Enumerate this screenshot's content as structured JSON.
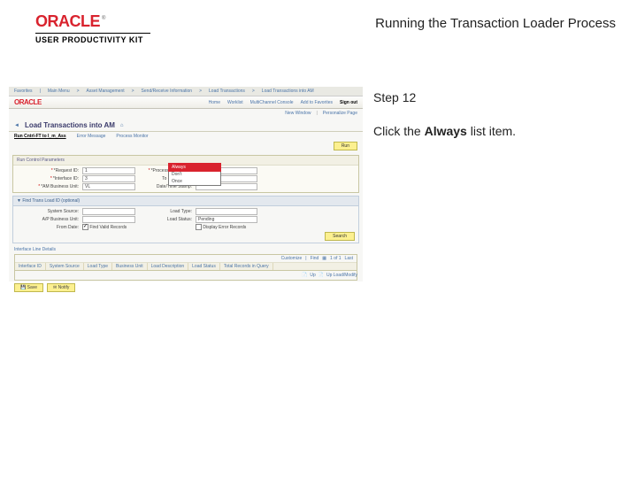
{
  "header": {
    "brand": "ORACLE",
    "sub": "USER PRODUCTIVITY KIT",
    "title": "Running the Transaction Loader Process"
  },
  "instr": {
    "step": "Step 12",
    "text_before": "Click the ",
    "bold": "Always",
    "text_after": " list item."
  },
  "screenshot": {
    "nav": [
      "Favorites",
      "Main Menu",
      "Asset Management",
      "Send/Receive Information",
      "Load Transactions",
      "Load Transactions into AM"
    ],
    "brand": "ORACLE",
    "top_links": [
      "Home",
      "Worklist",
      "MultiChannel Console",
      "Add to Favorites"
    ],
    "signout": "Sign out",
    "new_window": "New Window",
    "personalize": "Personalize Page",
    "back_symbol": "◄",
    "page_title": "Load Transactions into AM",
    "tabs": [
      "Run Cntrl-FT to I_m_Ass",
      "Error Message",
      "Process Monitor"
    ],
    "run_btn": "Run",
    "group1": {
      "title": "Run Control Parameters",
      "rows": {
        "request_id": {
          "label": "*Request ID:",
          "value": "1"
        },
        "process_freq": {
          "label": "*Process Frequency:",
          "value": "Always"
        },
        "interface_id": {
          "label": "*Interface ID:",
          "value": "3"
        },
        "to_interface": {
          "label": "To Interface ID:",
          "value": ""
        },
        "am_bu": {
          "label": "*AM Business Unit:",
          "value": "VL"
        },
        "datetime_stamp": {
          "label": "Date/Time Stamp:",
          "value": ""
        }
      },
      "dropdown_options": [
        "Always",
        "Don't",
        "Once"
      ],
      "dropdown_highlight": "Always"
    },
    "group2": {
      "title": "▼ Find Trans Load ID (optional)",
      "rows": {
        "system_source": {
          "label": "System Source:",
          "value": ""
        },
        "load_type": {
          "label": "Load Type:",
          "value": ""
        },
        "ap_bu": {
          "label": "A/P Business Unit:",
          "value": ""
        },
        "load_status": {
          "label": "Load Status:",
          "value": "Pending"
        },
        "from_date": {
          "label": "From Date:",
          "value": ""
        },
        "find_valid": {
          "label": "Find Valid Records",
          "checked": true
        },
        "display_err": {
          "label": "Display Error Records",
          "checked": false
        }
      },
      "search_btn": "Search"
    },
    "table": {
      "title": "Interface Line Details",
      "toolbar": {
        "customize": "Customize",
        "find": "Find",
        "range": "1 of 1",
        "last": "Last"
      },
      "columns": [
        "Interface ID",
        "System Source",
        "Load Type",
        "Business Unit",
        "Load Description",
        "Load Status",
        "Total Records in Query"
      ]
    },
    "actions": {
      "save": "Save",
      "notify": "Notify"
    },
    "pager": {
      "up": "Up",
      "modify": "Up Load/Modify"
    }
  }
}
